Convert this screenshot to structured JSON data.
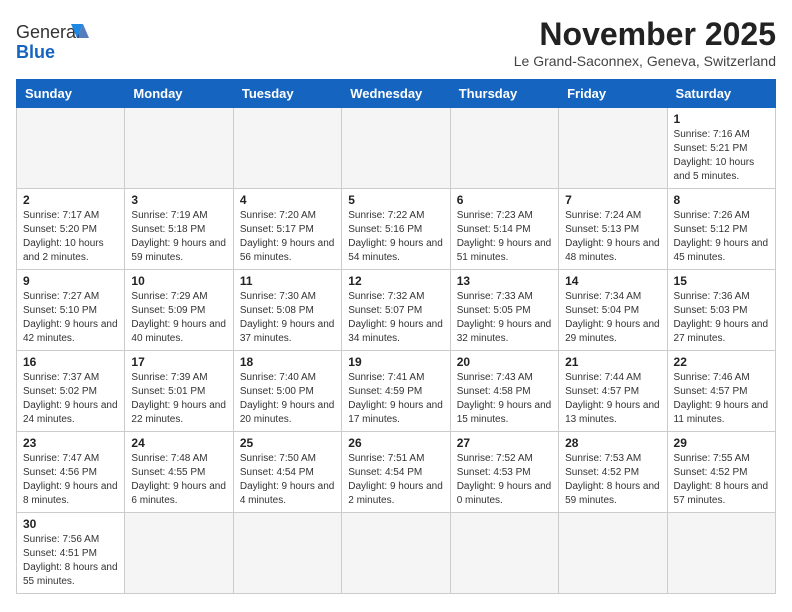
{
  "header": {
    "logo_general": "General",
    "logo_blue": "Blue",
    "month_title": "November 2025",
    "location": "Le Grand-Saconnex, Geneva, Switzerland"
  },
  "days_of_week": [
    "Sunday",
    "Monday",
    "Tuesday",
    "Wednesday",
    "Thursday",
    "Friday",
    "Saturday"
  ],
  "weeks": [
    [
      {
        "day": "",
        "info": ""
      },
      {
        "day": "",
        "info": ""
      },
      {
        "day": "",
        "info": ""
      },
      {
        "day": "",
        "info": ""
      },
      {
        "day": "",
        "info": ""
      },
      {
        "day": "",
        "info": ""
      },
      {
        "day": "1",
        "info": "Sunrise: 7:16 AM\nSunset: 5:21 PM\nDaylight: 10 hours and 5 minutes."
      }
    ],
    [
      {
        "day": "2",
        "info": "Sunrise: 7:17 AM\nSunset: 5:20 PM\nDaylight: 10 hours and 2 minutes."
      },
      {
        "day": "3",
        "info": "Sunrise: 7:19 AM\nSunset: 5:18 PM\nDaylight: 9 hours and 59 minutes."
      },
      {
        "day": "4",
        "info": "Sunrise: 7:20 AM\nSunset: 5:17 PM\nDaylight: 9 hours and 56 minutes."
      },
      {
        "day": "5",
        "info": "Sunrise: 7:22 AM\nSunset: 5:16 PM\nDaylight: 9 hours and 54 minutes."
      },
      {
        "day": "6",
        "info": "Sunrise: 7:23 AM\nSunset: 5:14 PM\nDaylight: 9 hours and 51 minutes."
      },
      {
        "day": "7",
        "info": "Sunrise: 7:24 AM\nSunset: 5:13 PM\nDaylight: 9 hours and 48 minutes."
      },
      {
        "day": "8",
        "info": "Sunrise: 7:26 AM\nSunset: 5:12 PM\nDaylight: 9 hours and 45 minutes."
      }
    ],
    [
      {
        "day": "9",
        "info": "Sunrise: 7:27 AM\nSunset: 5:10 PM\nDaylight: 9 hours and 42 minutes."
      },
      {
        "day": "10",
        "info": "Sunrise: 7:29 AM\nSunset: 5:09 PM\nDaylight: 9 hours and 40 minutes."
      },
      {
        "day": "11",
        "info": "Sunrise: 7:30 AM\nSunset: 5:08 PM\nDaylight: 9 hours and 37 minutes."
      },
      {
        "day": "12",
        "info": "Sunrise: 7:32 AM\nSunset: 5:07 PM\nDaylight: 9 hours and 34 minutes."
      },
      {
        "day": "13",
        "info": "Sunrise: 7:33 AM\nSunset: 5:05 PM\nDaylight: 9 hours and 32 minutes."
      },
      {
        "day": "14",
        "info": "Sunrise: 7:34 AM\nSunset: 5:04 PM\nDaylight: 9 hours and 29 minutes."
      },
      {
        "day": "15",
        "info": "Sunrise: 7:36 AM\nSunset: 5:03 PM\nDaylight: 9 hours and 27 minutes."
      }
    ],
    [
      {
        "day": "16",
        "info": "Sunrise: 7:37 AM\nSunset: 5:02 PM\nDaylight: 9 hours and 24 minutes."
      },
      {
        "day": "17",
        "info": "Sunrise: 7:39 AM\nSunset: 5:01 PM\nDaylight: 9 hours and 22 minutes."
      },
      {
        "day": "18",
        "info": "Sunrise: 7:40 AM\nSunset: 5:00 PM\nDaylight: 9 hours and 20 minutes."
      },
      {
        "day": "19",
        "info": "Sunrise: 7:41 AM\nSunset: 4:59 PM\nDaylight: 9 hours and 17 minutes."
      },
      {
        "day": "20",
        "info": "Sunrise: 7:43 AM\nSunset: 4:58 PM\nDaylight: 9 hours and 15 minutes."
      },
      {
        "day": "21",
        "info": "Sunrise: 7:44 AM\nSunset: 4:57 PM\nDaylight: 9 hours and 13 minutes."
      },
      {
        "day": "22",
        "info": "Sunrise: 7:46 AM\nSunset: 4:57 PM\nDaylight: 9 hours and 11 minutes."
      }
    ],
    [
      {
        "day": "23",
        "info": "Sunrise: 7:47 AM\nSunset: 4:56 PM\nDaylight: 9 hours and 8 minutes."
      },
      {
        "day": "24",
        "info": "Sunrise: 7:48 AM\nSunset: 4:55 PM\nDaylight: 9 hours and 6 minutes."
      },
      {
        "day": "25",
        "info": "Sunrise: 7:50 AM\nSunset: 4:54 PM\nDaylight: 9 hours and 4 minutes."
      },
      {
        "day": "26",
        "info": "Sunrise: 7:51 AM\nSunset: 4:54 PM\nDaylight: 9 hours and 2 minutes."
      },
      {
        "day": "27",
        "info": "Sunrise: 7:52 AM\nSunset: 4:53 PM\nDaylight: 9 hours and 0 minutes."
      },
      {
        "day": "28",
        "info": "Sunrise: 7:53 AM\nSunset: 4:52 PM\nDaylight: 8 hours and 59 minutes."
      },
      {
        "day": "29",
        "info": "Sunrise: 7:55 AM\nSunset: 4:52 PM\nDaylight: 8 hours and 57 minutes."
      }
    ],
    [
      {
        "day": "30",
        "info": "Sunrise: 7:56 AM\nSunset: 4:51 PM\nDaylight: 8 hours and 55 minutes."
      },
      {
        "day": "",
        "info": ""
      },
      {
        "day": "",
        "info": ""
      },
      {
        "day": "",
        "info": ""
      },
      {
        "day": "",
        "info": ""
      },
      {
        "day": "",
        "info": ""
      },
      {
        "day": "",
        "info": ""
      }
    ]
  ]
}
